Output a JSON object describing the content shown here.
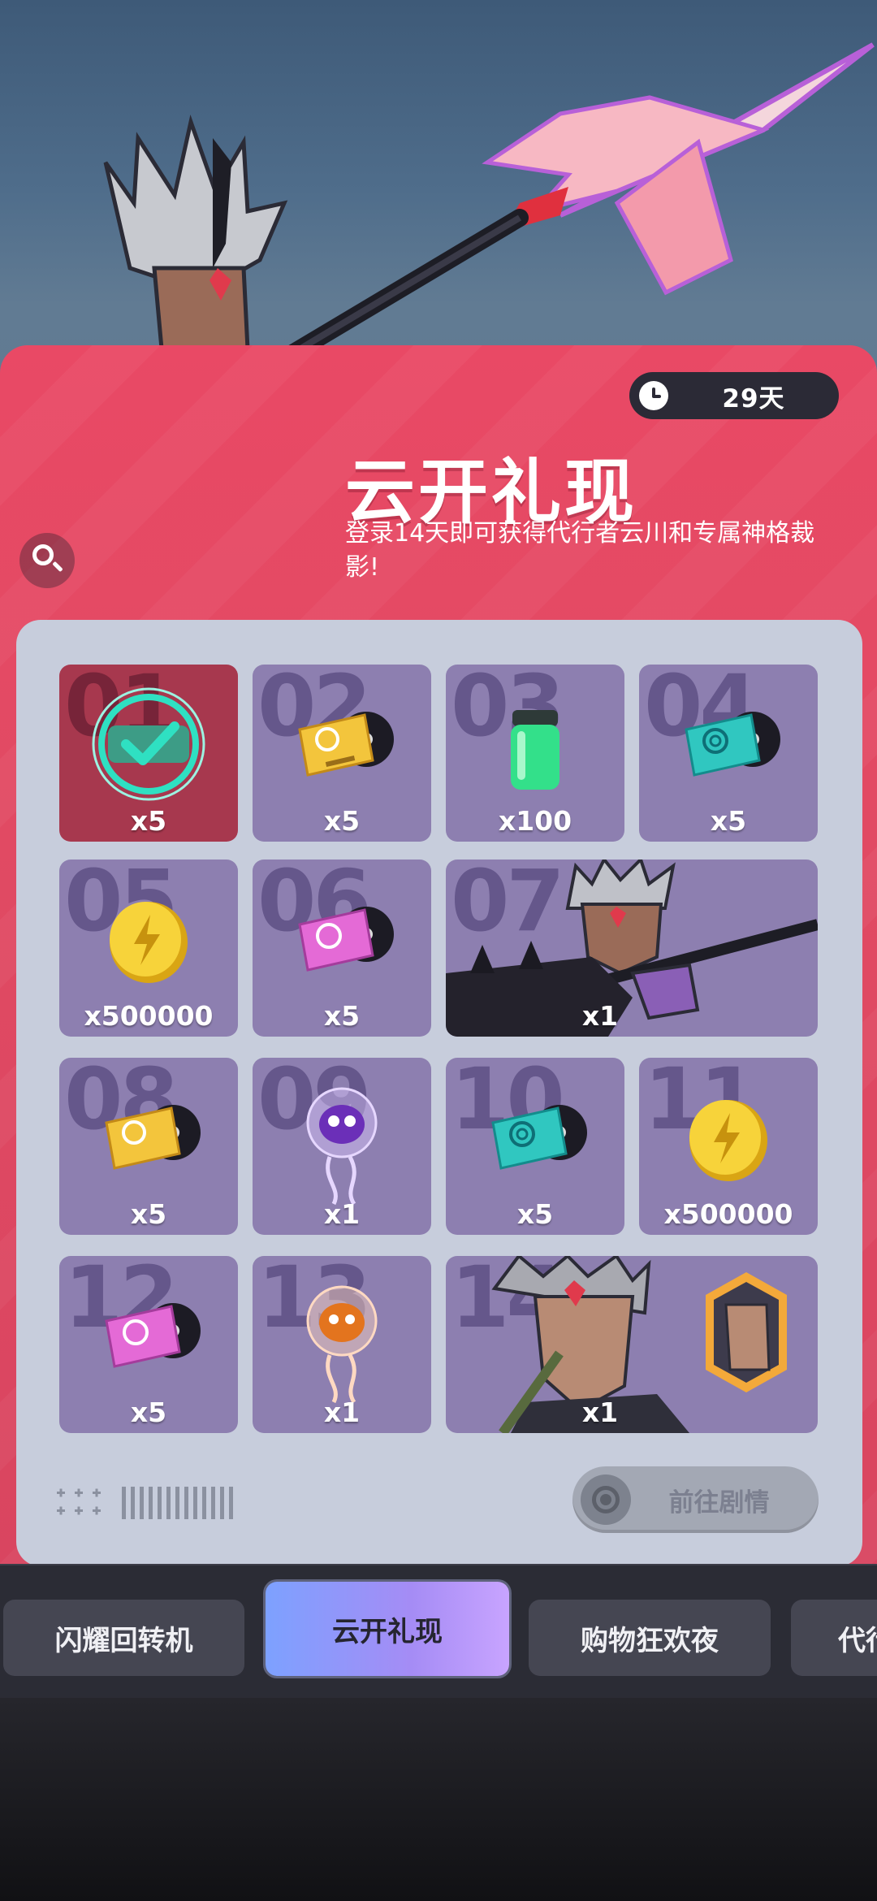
{
  "event": {
    "days_left": "29天",
    "title": "云开礼现",
    "description": "登录14天即可获得代行者云川和专属神格裁影!",
    "story_button": "前往剧情"
  },
  "rewards": [
    {
      "day": "01",
      "item": "mech-core",
      "qty": "x5",
      "claimed": true
    },
    {
      "day": "02",
      "item": "gold-ticket-disc",
      "qty": "x5",
      "claimed": false
    },
    {
      "day": "03",
      "item": "green-energy-canister",
      "qty": "x100",
      "claimed": false
    },
    {
      "day": "04",
      "item": "teal-ticket-disc",
      "qty": "x5",
      "claimed": false
    },
    {
      "day": "05",
      "item": "gold-coin",
      "qty": "x500000",
      "claimed": false
    },
    {
      "day": "06",
      "item": "pink-ticket-disc",
      "qty": "x5",
      "claimed": false
    },
    {
      "day": "07",
      "item": "agent-character-card",
      "qty": "x1",
      "claimed": false
    },
    {
      "day": "08",
      "item": "gold-ticket-disc",
      "qty": "x5",
      "claimed": false
    },
    {
      "day": "09",
      "item": "purple-jellyfish-pet",
      "qty": "x1",
      "claimed": false
    },
    {
      "day": "10",
      "item": "teal-ticket-disc",
      "qty": "x5",
      "claimed": false
    },
    {
      "day": "11",
      "item": "gold-coin",
      "qty": "x500000",
      "claimed": false
    },
    {
      "day": "12",
      "item": "pink-ticket-disc",
      "qty": "x5",
      "claimed": false
    },
    {
      "day": "13",
      "item": "orange-jellyfish-pet",
      "qty": "x1",
      "claimed": false
    },
    {
      "day": "14",
      "item": "divine-shadow-card",
      "qty": "x1",
      "claimed": false
    }
  ],
  "tabs": [
    {
      "label": "闪耀回转机",
      "active": false
    },
    {
      "label": "云开礼现",
      "active": true
    },
    {
      "label": "购物狂欢夜",
      "active": false
    },
    {
      "label": "代行",
      "active": false
    }
  ],
  "colors": {
    "panel_red": "#e94965",
    "tile_purple": "#8d7fb0",
    "claimed_red": "#a7384e",
    "active_tab": "#a58cf5",
    "check_teal": "#2fe0c2"
  }
}
